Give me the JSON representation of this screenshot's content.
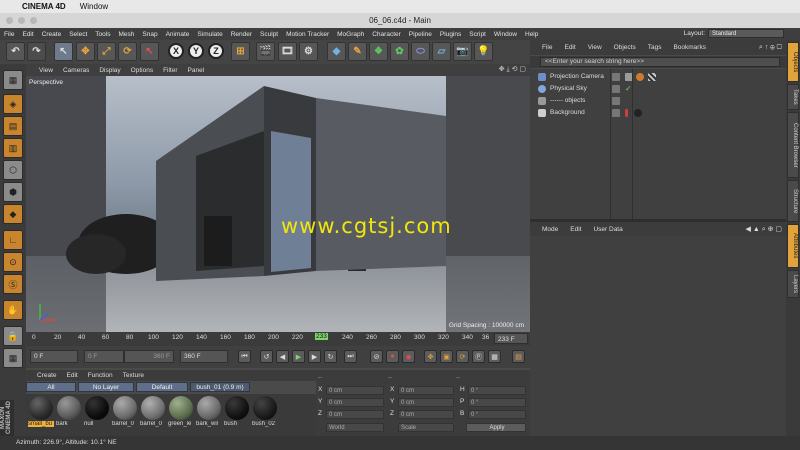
{
  "macmenu": {
    "app": "CINEMA 4D",
    "items": [
      "Window"
    ]
  },
  "window": {
    "title": "06_06.c4d - Main"
  },
  "appmenu": [
    "File",
    "Edit",
    "Create",
    "Select",
    "Tools",
    "Mesh",
    "Snap",
    "Animate",
    "Simulate",
    "Render",
    "Sculpt",
    "Motion Tracker",
    "MoGraph",
    "Character",
    "Pipeline",
    "Plugins",
    "Script",
    "Window",
    "Help"
  ],
  "layout": {
    "label": "Layout:",
    "value": "Standard"
  },
  "toolbar": {
    "axis_x": "X",
    "axis_y": "Y",
    "axis_z": "Z"
  },
  "viewport": {
    "menu": [
      "View",
      "Cameras",
      "Display",
      "Options",
      "Filter",
      "Panel"
    ],
    "label": "Perspective",
    "watermark": "www.cgtsj.com",
    "grid_spacing": "Grid Spacing : 100000 cm"
  },
  "timeline": {
    "ticks": [
      "0",
      "20",
      "40",
      "60",
      "80",
      "100",
      "120",
      "140",
      "160",
      "180",
      "200",
      "220",
      "233",
      "240",
      "260",
      "280",
      "300",
      "320",
      "340",
      "36"
    ],
    "current": "233",
    "end_field": "233 F"
  },
  "playbar": {
    "start": "0 F",
    "range_start": "0 F",
    "range_end": "360 F",
    "end": "360 F"
  },
  "materials": {
    "menu": [
      "Create",
      "Edit",
      "Function",
      "Texture"
    ],
    "filters": [
      "All",
      "No Layer",
      "Default",
      "bush_01 (0.9 m)"
    ],
    "items": [
      {
        "label": "small_bu",
        "color": "#2a2a2a"
      },
      {
        "label": "bark",
        "color": "#5a5a5a"
      },
      {
        "label": "null",
        "color": "#0c0c0c"
      },
      {
        "label": "barrel_0",
        "color": "#6c6c6c"
      },
      {
        "label": "barrel_0",
        "color": "#707070"
      },
      {
        "label": "green_le",
        "color": "#5c6f4f"
      },
      {
        "label": "bark_wil",
        "color": "#6a6a6a"
      },
      {
        "label": "bush",
        "color": "#111111"
      },
      {
        "label": "bush_02",
        "color": "#1a1a1a"
      }
    ]
  },
  "coords": {
    "rows": [
      {
        "axis": "X",
        "pos": "0 cm",
        "axis2": "X",
        "size": "0 cm",
        "rot_label": "H",
        "rot": "0 °"
      },
      {
        "axis": "Y",
        "pos": "0 cm",
        "axis2": "Y",
        "size": "0 cm",
        "rot_label": "P",
        "rot": "0 °"
      },
      {
        "axis": "Z",
        "pos": "0 cm",
        "axis2": "Z",
        "size": "0 cm",
        "rot_label": "B",
        "rot": "0 °"
      }
    ],
    "mode1": "World",
    "mode2": "Scale",
    "apply": "Apply"
  },
  "objects": {
    "menu": [
      "File",
      "Edit",
      "View",
      "Objects",
      "Tags",
      "Bookmarks"
    ],
    "search_placeholder": "<<Enter your search string here>>",
    "items": [
      {
        "name": "Projection Camera",
        "color": "#6d8fc7"
      },
      {
        "name": "Physical Sky",
        "color": "#7fa7d9"
      },
      {
        "name": "------ objects",
        "color": "#999999"
      },
      {
        "name": "Background",
        "color": "#cfcfcf"
      }
    ]
  },
  "attributes": {
    "menu": [
      "Mode",
      "Edit",
      "User Data"
    ]
  },
  "righttabs": [
    "Objects",
    "Takes",
    "Content Browser",
    "Structure",
    "Attributes",
    "Layers"
  ],
  "status": {
    "text": "Azimuth: 226.9°, Altitude: 10.1°  NE"
  },
  "maxon": "MAXON CINEMA 4D",
  "colors": {
    "accent": "#e3a33b",
    "watermark": "#f2e60a",
    "selection": "#5f6f8a"
  }
}
